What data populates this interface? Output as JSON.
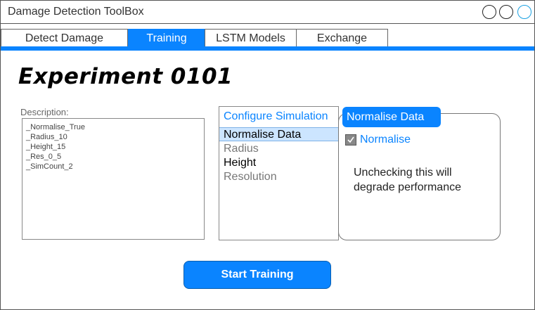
{
  "window": {
    "title": "Damage Detection ToolBox",
    "accent_color": "#0a84ff"
  },
  "tabs": [
    {
      "label": "Detect Damage",
      "active": false
    },
    {
      "label": "Training",
      "active": true
    },
    {
      "label": "LSTM Models",
      "active": false
    },
    {
      "label": "Exchange",
      "active": false
    }
  ],
  "main": {
    "heading": "Experiment 0101",
    "description": {
      "label": "Description:",
      "lines": [
        "_Normalise_True",
        "_Radius_10",
        "_Height_15",
        "_Res_0_5",
        "_SimCount_2"
      ]
    },
    "config": {
      "title": "Configure Simulation",
      "items": [
        {
          "label": "Normalise Data",
          "state": "selected"
        },
        {
          "label": "Radius",
          "state": "disabled"
        },
        {
          "label": "Height",
          "state": "enabled"
        },
        {
          "label": "Resolution",
          "state": "disabled"
        }
      ]
    },
    "normalise_panel": {
      "title": "Normalise Data",
      "checkbox_label": "Normalise",
      "checked": true,
      "warning": "Unchecking this will degrade performance"
    },
    "start_button": "Start Training"
  }
}
